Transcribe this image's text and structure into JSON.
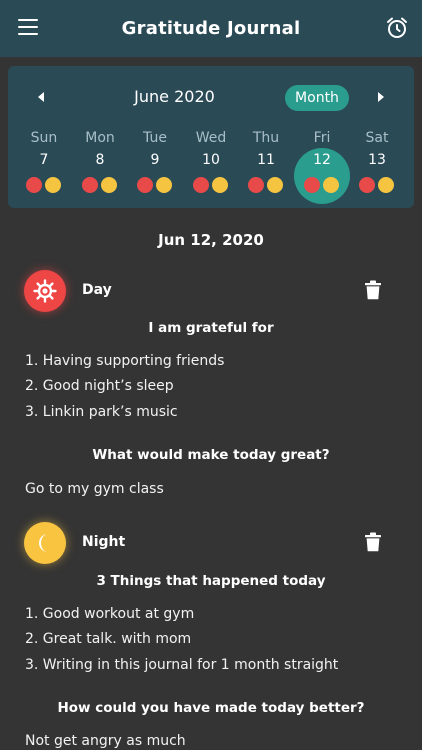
{
  "app": {
    "title": "Gratitude Journal"
  },
  "calendar": {
    "month_label": "June 2020",
    "view_toggle": "Month",
    "days": [
      {
        "name": "Sun",
        "num": "7",
        "selected": false
      },
      {
        "name": "Mon",
        "num": "8",
        "selected": false
      },
      {
        "name": "Tue",
        "num": "9",
        "selected": false
      },
      {
        "name": "Wed",
        "num": "10",
        "selected": false
      },
      {
        "name": "Thu",
        "num": "11",
        "selected": false
      },
      {
        "name": "Fri",
        "num": "12",
        "selected": true
      },
      {
        "name": "Sat",
        "num": "13",
        "selected": false
      }
    ]
  },
  "date_heading": "Jun 12, 2020",
  "day_entry": {
    "title": "Day",
    "q1_title": "I am grateful for",
    "q1_items": [
      "1. Having supporting friends",
      "2. Good night’s sleep",
      "3. Linkin park’s music"
    ],
    "q2_title": "What would make today great?",
    "q2_answer": "Go to my gym class"
  },
  "night_entry": {
    "title": "Night",
    "q1_title": "3 Things that happened today",
    "q1_items": [
      "1. Good workout at gym",
      "2. Great talk. with mom",
      "3. Writing in this journal for 1 month straight"
    ],
    "q2_title": "How could you have made today better?",
    "q2_answer": "Not get angry as much"
  },
  "colors": {
    "header_bg": "#2a4a56",
    "accent_teal": "#2a9d8f",
    "day_red": "#ee4545",
    "night_yellow": "#f9c440",
    "page_bg": "#343434"
  },
  "icons": [
    "menu-icon",
    "alarm-clock-icon",
    "chevron-left-icon",
    "chevron-right-icon",
    "sun-icon",
    "moon-icon",
    "trash-icon"
  ]
}
